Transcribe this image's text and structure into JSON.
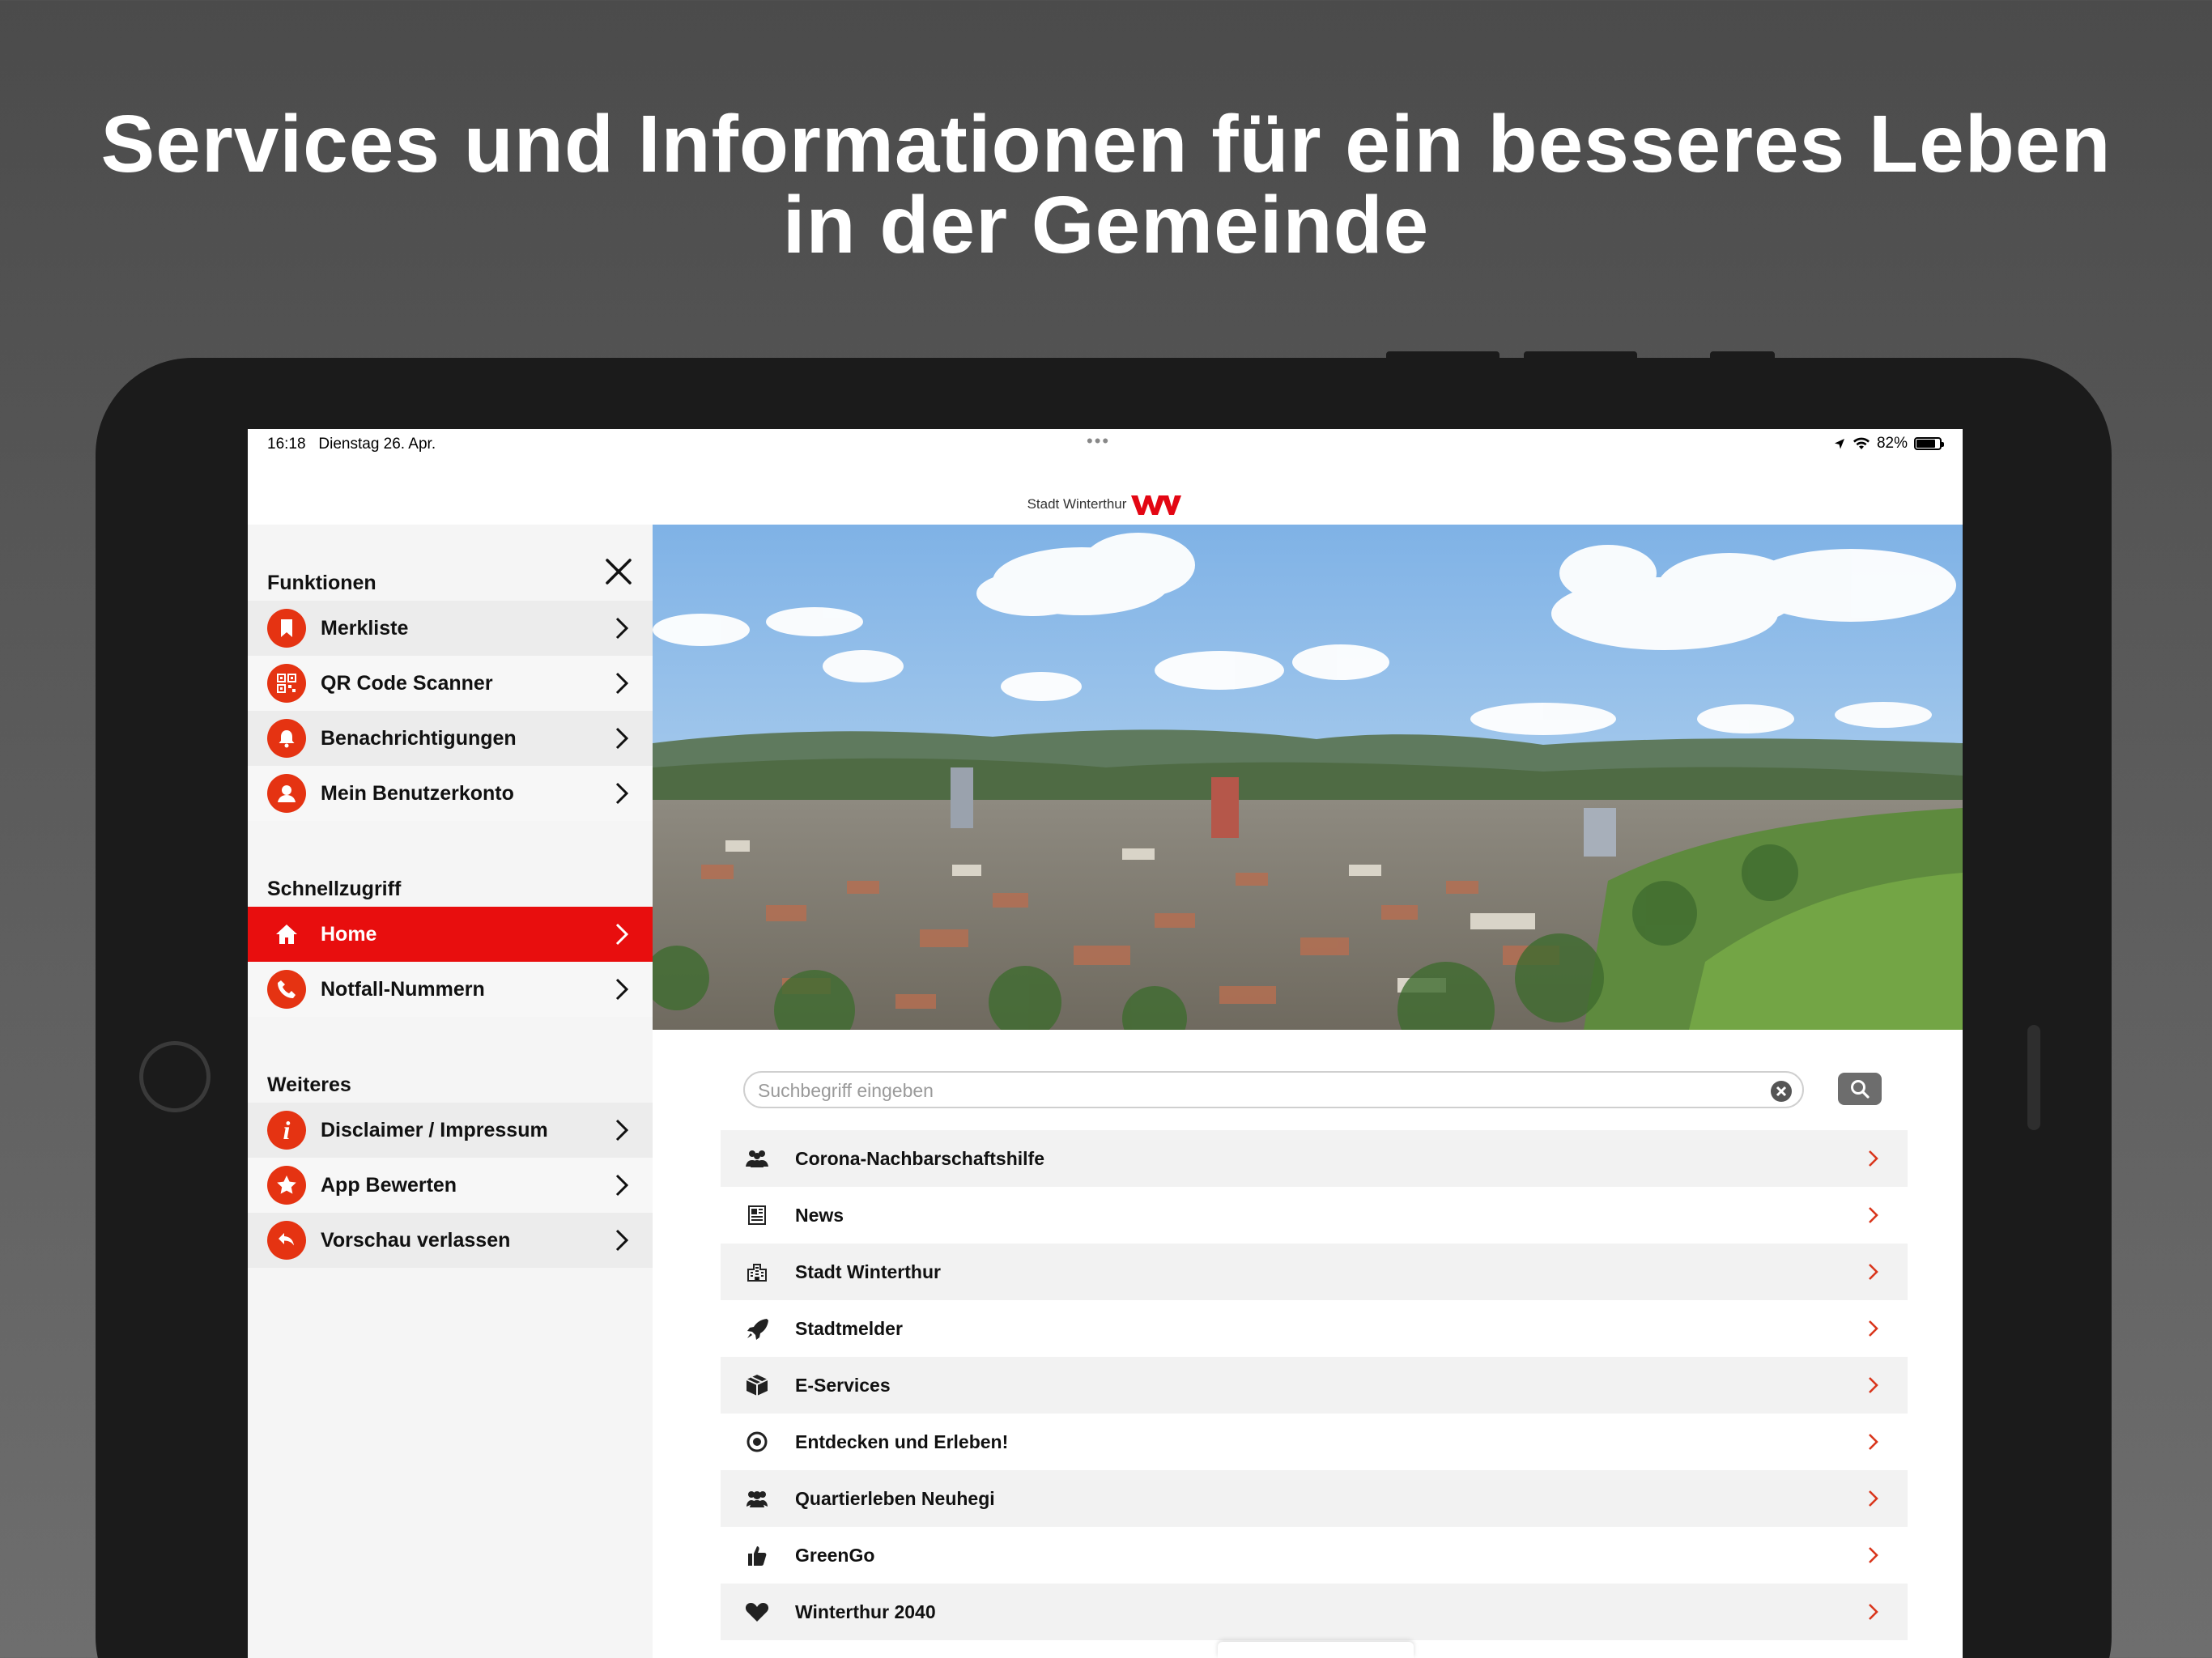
{
  "headline": {
    "line1": "Services und Informationen für ein besseres Leben",
    "line2": "in der Gemeinde"
  },
  "status_bar": {
    "time": "16:18",
    "date": "Dienstag 26. Apr.",
    "multitask_dots": "•••",
    "battery": "82%",
    "battery_level": 0.82
  },
  "brand": {
    "name": "Stadt Winterthur",
    "logo_color": "#e30613"
  },
  "sidebar": {
    "sections": [
      {
        "title": "Funktionen",
        "items": [
          {
            "label": "Merkliste",
            "icon": "bookmark-icon"
          },
          {
            "label": "QR Code Scanner",
            "icon": "qr-code-icon"
          },
          {
            "label": "Benachrichtigungen",
            "icon": "bell-icon"
          },
          {
            "label": "Mein Benutzerkonto",
            "icon": "user-icon"
          }
        ]
      },
      {
        "title": "Schnellzugriff",
        "items": [
          {
            "label": "Home",
            "icon": "home-icon",
            "active": true
          },
          {
            "label": "Notfall-Nummern",
            "icon": "phone-icon"
          }
        ]
      },
      {
        "title": "Weiteres",
        "items": [
          {
            "label": "Disclaimer / Impressum",
            "icon": "info-icon"
          },
          {
            "label": "App Bewerten",
            "icon": "star-icon"
          },
          {
            "label": "Vorschau verlassen",
            "icon": "back-arrow-icon"
          }
        ]
      }
    ]
  },
  "search": {
    "placeholder": "Suchbegriff eingeben",
    "value": ""
  },
  "menu": {
    "items": [
      {
        "label": "Corona-Nachbarschaftshilfe",
        "icon": "people-icon"
      },
      {
        "label": "News",
        "icon": "newspaper-icon"
      },
      {
        "label": "Stadt Winterthur",
        "icon": "city-icon"
      },
      {
        "label": "Stadtmelder",
        "icon": "rocket-icon"
      },
      {
        "label": "E-Services",
        "icon": "package-icon"
      },
      {
        "label": "Entdecken und Erleben!",
        "icon": "target-icon"
      },
      {
        "label": "Quartierleben Neuhegi",
        "icon": "group-icon"
      },
      {
        "label": "GreenGo",
        "icon": "thumbs-up-icon"
      },
      {
        "label": "Winterthur 2040",
        "icon": "heart-icon"
      }
    ]
  },
  "colors": {
    "accent": "#e80e0e",
    "icon_red": "#e53312",
    "chevron": "#d9361c"
  }
}
